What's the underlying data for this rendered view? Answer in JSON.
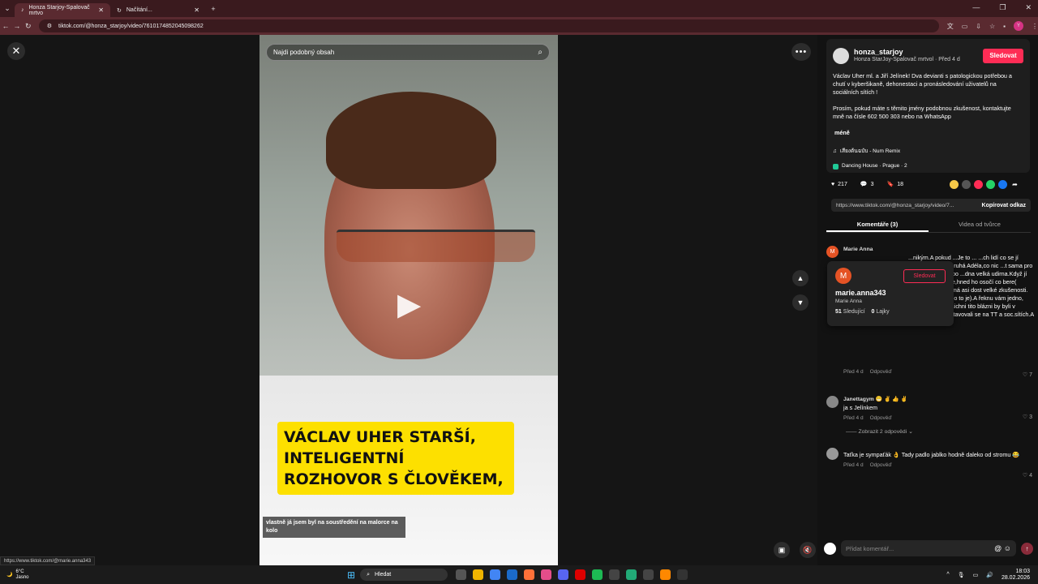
{
  "browser": {
    "tabs": [
      {
        "title": "Honza Starjoy-Spalovač mrtvo"
      },
      {
        "title": "Načítání..."
      }
    ],
    "url": "tiktok.com/@honza_starjoy/video/7610174852045098262",
    "profile_initial": "Y"
  },
  "viewer": {
    "search_placeholder": "Najdi podobný obsah",
    "caption_line1": "VÁCLAV UHER STARŠÍ,",
    "caption_line2": "INTELIGENTNÍ ROZHOVOR S ČLOVĚKEM,",
    "subtitle": "vlastně já jsem byl na soustředění na malorce na kolo"
  },
  "post": {
    "username": "honza_starjoy",
    "subline": "Honza StarJoy-Spalovač mrtvol · Před 4 d",
    "follow": "Sledovat",
    "desc_p1": "Václav Uher ml. a Jiří Jelínek! Dva devianti s patologickou potřebou a chutí v kyberšikaně, dehonestaci a pronásledování uživatelů na sociálních sítích !",
    "desc_p2": "Prosím, pokud máte s těmito jmény podobnou zkušenost, kontaktujte mně na čísle 602 500 303 nebo na WhatsApp",
    "less": "méně",
    "music": "เสียงต้นฉบับ - Num Remix",
    "place": "Dancing House · Prague · 2",
    "likes": "217",
    "comments": "3",
    "saves": "18",
    "link": "https://www.tiktok.com/@honza_starjoy/video/7...",
    "copy_link": "Kopírovat odkaz",
    "tab_comments": "Komentáře (3)",
    "tab_videos": "Videa od tvůrce"
  },
  "comments": [
    {
      "name": "Marie Anna",
      "text": "...nikým.A pokud ...Je to ... ...ch lidí co se jí ...ilky,chodili na ...ruhá Adéla,co nic ...t sama pro ...ák, pije pivo,nebo ...dna velká udirna.Když jí člověk něco řekne,hned ho osočí co bere( houbičky),s těmi má asi dost velké zkušenosti.(já ani nevěděla co to je).A řeknu vám jedno, zlatí komunisti, všichni tito blázni by byli v ústavech a nevystavovali se na TT a soc.sítích.A že jich tady je.",
      "time": "Před 4 d",
      "reply": "Odpověď",
      "likes": "7"
    },
    {
      "name": "Janettagym 😁 ✌️ 👍 ✌️",
      "text": "ja s Jelínkem",
      "time": "Před 4 d",
      "reply": "Odpověď",
      "likes": "3",
      "replies": "Zobrazit 2 odpovědi"
    },
    {
      "name": "",
      "text": "Taťka je sympaťák 👌 Tady padlo jablko hodně daleko od stromu 😂",
      "time": "Před 4 d",
      "reply": "Odpověď",
      "likes": "4"
    }
  ],
  "popup": {
    "initial": "M",
    "follow": "Sledovat",
    "handle": "marie.anna343",
    "name": "Marie Anna",
    "followers": "51",
    "followers_label": "Sledující",
    "likes": "0",
    "likes_label": "Lajky"
  },
  "comment_input": {
    "placeholder": "Přidat komentář..."
  },
  "status_url": "https://www.tiktok.com/@marie.anna343",
  "taskbar": {
    "temp": "6°C",
    "weather": "Jasno",
    "search": "Hledat",
    "time": "18:03",
    "date": "28.02.2026"
  },
  "colors": {
    "accent": "#fe2c55",
    "caption_bg": "#fde000"
  }
}
